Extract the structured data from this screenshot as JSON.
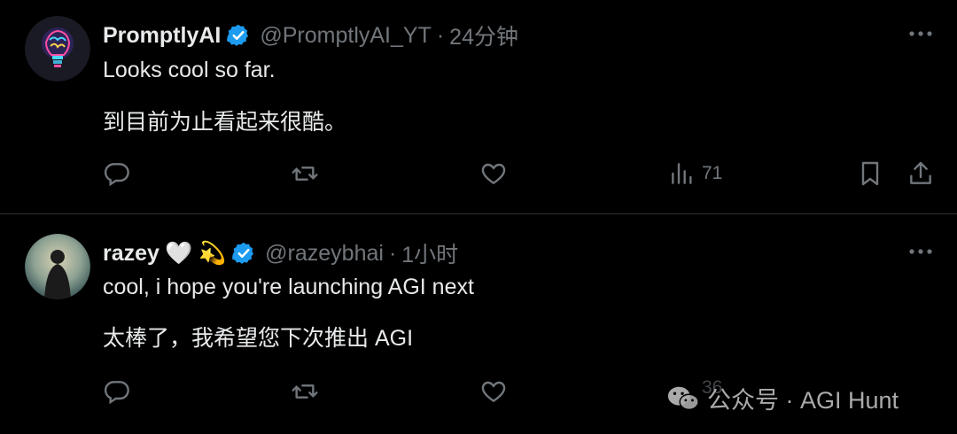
{
  "tweets": [
    {
      "display_name": "PromptlyAI",
      "handle": "@PromptlyAI_YT",
      "separator": "·",
      "time": "24分钟",
      "text_en": "Looks cool so far.",
      "text_zh": "到目前为止看起来很酷。",
      "views": "71"
    },
    {
      "display_name": "razey",
      "emoji": "🤍 💫",
      "handle": "@razeybhai",
      "separator": "·",
      "time": "1小时",
      "text_en": "cool, i hope you're launching AGI next",
      "text_zh": "太棒了，我希望您下次推出 AGI",
      "views": "36"
    }
  ],
  "watermark": {
    "label": "公众号 · AGI Hunt"
  },
  "colors": {
    "background": "#000000",
    "text": "#e7e9ea",
    "muted": "#71767b",
    "verified": "#1d9bf0",
    "divider": "#2f3336"
  },
  "icons": [
    "verified-badge-icon",
    "more-icon",
    "reply-icon",
    "retweet-icon",
    "like-icon",
    "views-icon",
    "bookmark-icon",
    "share-icon",
    "wechat-icon"
  ]
}
